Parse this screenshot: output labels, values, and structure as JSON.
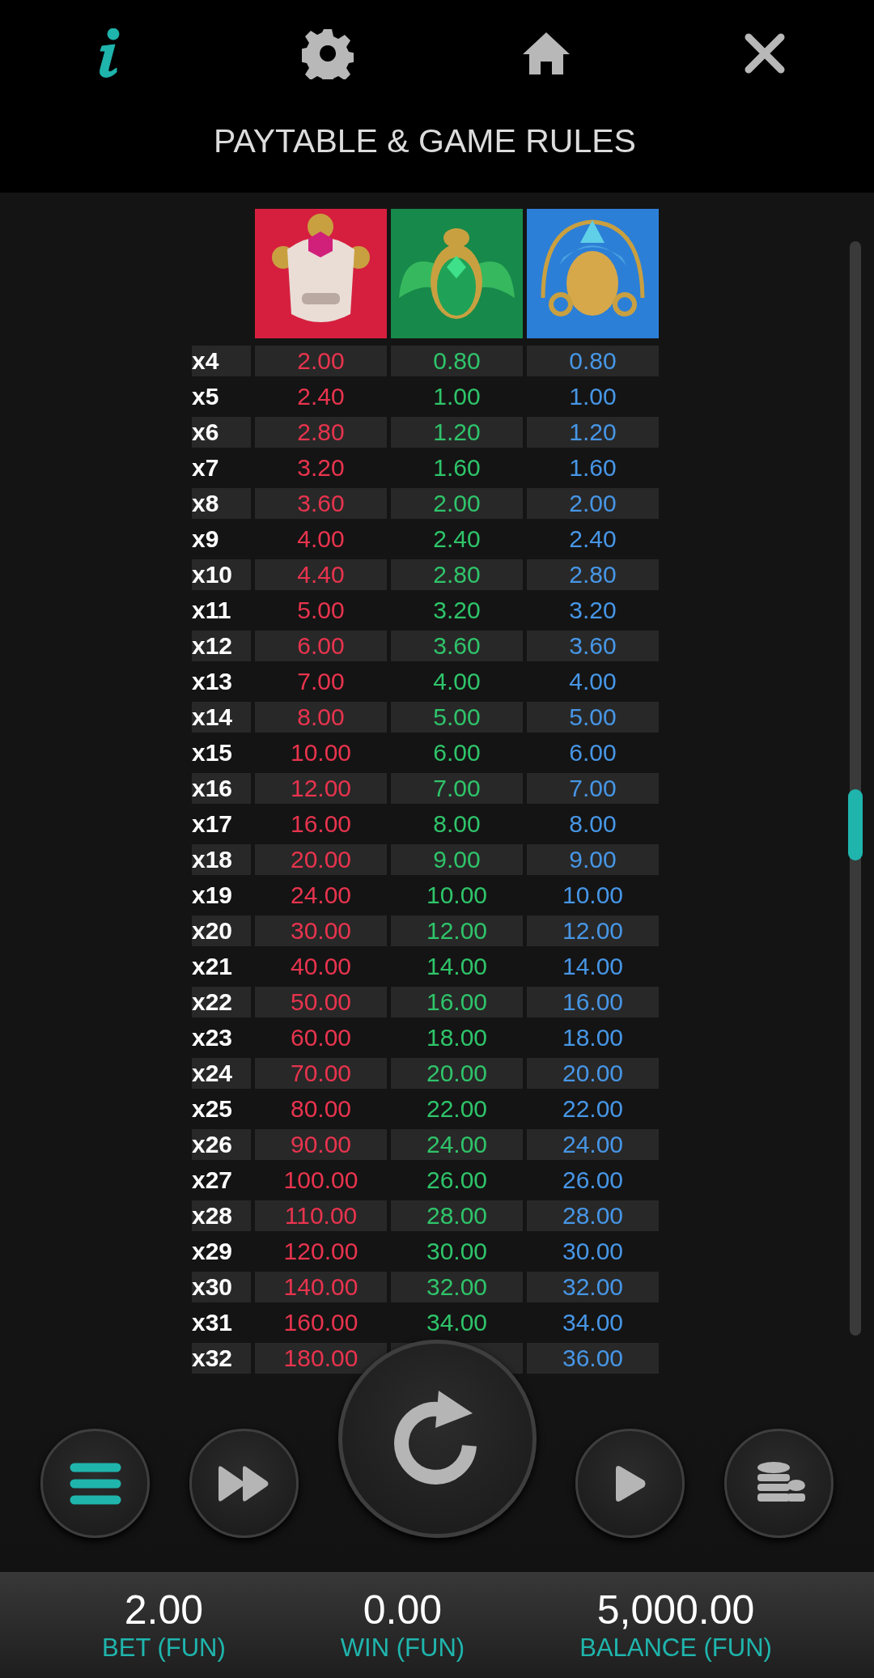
{
  "top_bar": {
    "icons": [
      {
        "kind": "info",
        "selected": true
      },
      {
        "kind": "settings",
        "selected": false
      },
      {
        "kind": "home",
        "selected": false
      },
      {
        "kind": "close",
        "selected": false
      }
    ],
    "title": "PAYTABLE & GAME RULES"
  },
  "paytable": {
    "symbols": [
      {
        "kind": "lion",
        "color": "#e8344e"
      },
      {
        "kind": "scarab",
        "color": "#2fc46a"
      },
      {
        "kind": "mask",
        "color": "#4796e6"
      }
    ],
    "rows": [
      {
        "count": "x4",
        "pays": [
          "2.00",
          "0.80",
          "0.80"
        ]
      },
      {
        "count": "x5",
        "pays": [
          "2.40",
          "1.00",
          "1.00"
        ]
      },
      {
        "count": "x6",
        "pays": [
          "2.80",
          "1.20",
          "1.20"
        ]
      },
      {
        "count": "x7",
        "pays": [
          "3.20",
          "1.60",
          "1.60"
        ]
      },
      {
        "count": "x8",
        "pays": [
          "3.60",
          "2.00",
          "2.00"
        ]
      },
      {
        "count": "x9",
        "pays": [
          "4.00",
          "2.40",
          "2.40"
        ]
      },
      {
        "count": "x10",
        "pays": [
          "4.40",
          "2.80",
          "2.80"
        ]
      },
      {
        "count": "x11",
        "pays": [
          "5.00",
          "3.20",
          "3.20"
        ]
      },
      {
        "count": "x12",
        "pays": [
          "6.00",
          "3.60",
          "3.60"
        ]
      },
      {
        "count": "x13",
        "pays": [
          "7.00",
          "4.00",
          "4.00"
        ]
      },
      {
        "count": "x14",
        "pays": [
          "8.00",
          "5.00",
          "5.00"
        ]
      },
      {
        "count": "x15",
        "pays": [
          "10.00",
          "6.00",
          "6.00"
        ]
      },
      {
        "count": "x16",
        "pays": [
          "12.00",
          "7.00",
          "7.00"
        ]
      },
      {
        "count": "x17",
        "pays": [
          "16.00",
          "8.00",
          "8.00"
        ]
      },
      {
        "count": "x18",
        "pays": [
          "20.00",
          "9.00",
          "9.00"
        ]
      },
      {
        "count": "x19",
        "pays": [
          "24.00",
          "10.00",
          "10.00"
        ]
      },
      {
        "count": "x20",
        "pays": [
          "30.00",
          "12.00",
          "12.00"
        ]
      },
      {
        "count": "x21",
        "pays": [
          "40.00",
          "14.00",
          "14.00"
        ]
      },
      {
        "count": "x22",
        "pays": [
          "50.00",
          "16.00",
          "16.00"
        ]
      },
      {
        "count": "x23",
        "pays": [
          "60.00",
          "18.00",
          "18.00"
        ]
      },
      {
        "count": "x24",
        "pays": [
          "70.00",
          "20.00",
          "20.00"
        ]
      },
      {
        "count": "x25",
        "pays": [
          "80.00",
          "22.00",
          "22.00"
        ]
      },
      {
        "count": "x26",
        "pays": [
          "90.00",
          "24.00",
          "24.00"
        ]
      },
      {
        "count": "x27",
        "pays": [
          "100.00",
          "26.00",
          "26.00"
        ]
      },
      {
        "count": "x28",
        "pays": [
          "110.00",
          "28.00",
          "28.00"
        ]
      },
      {
        "count": "x29",
        "pays": [
          "120.00",
          "30.00",
          "30.00"
        ]
      },
      {
        "count": "x30",
        "pays": [
          "140.00",
          "32.00",
          "32.00"
        ]
      },
      {
        "count": "x31",
        "pays": [
          "160.00",
          "34.00",
          "34.00"
        ]
      },
      {
        "count": "x32",
        "kind": "middle_covered",
        "pays": [
          "180.00",
          "36.00"
        ]
      }
    ]
  },
  "controls": [
    {
      "kind": "menu"
    },
    {
      "kind": "turbo"
    },
    {
      "kind": "spin"
    },
    {
      "kind": "autoplay"
    },
    {
      "kind": "bet"
    }
  ],
  "status_bar": [
    {
      "value": "2.00",
      "label": "BET (FUN)"
    },
    {
      "value": "0.00",
      "label": "WIN (FUN)"
    },
    {
      "value": "5,000.00",
      "label": "BALANCE (FUN)"
    }
  ]
}
